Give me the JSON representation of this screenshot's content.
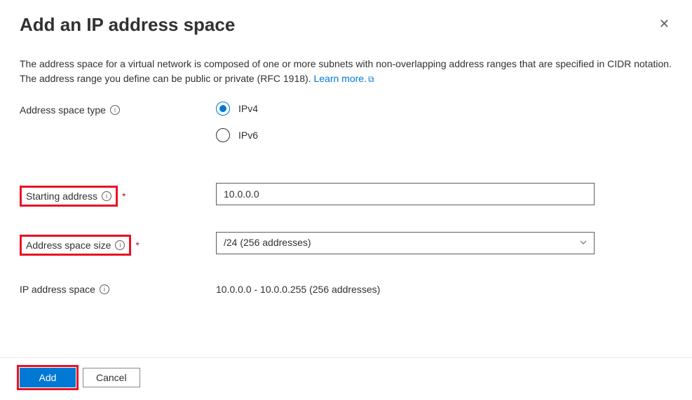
{
  "header": {
    "title": "Add an IP address space"
  },
  "description": {
    "text": "The address space for a virtual network is composed of one or more subnets with non-overlapping address ranges that are specified in CIDR notation. The address range you define can be public or private (RFC 1918).",
    "learn_more": "Learn more."
  },
  "fields": {
    "address_space_type": {
      "label": "Address space type",
      "options": {
        "ipv4": "IPv4",
        "ipv6": "IPv6"
      },
      "selected": "ipv4"
    },
    "starting_address": {
      "label": "Starting address",
      "value": "10.0.0.0"
    },
    "address_space_size": {
      "label": "Address space size",
      "value": "/24 (256 addresses)"
    },
    "ip_address_space": {
      "label": "IP address space",
      "value": "10.0.0.0 - 10.0.0.255 (256 addresses)"
    }
  },
  "buttons": {
    "add": "Add",
    "cancel": "Cancel"
  }
}
